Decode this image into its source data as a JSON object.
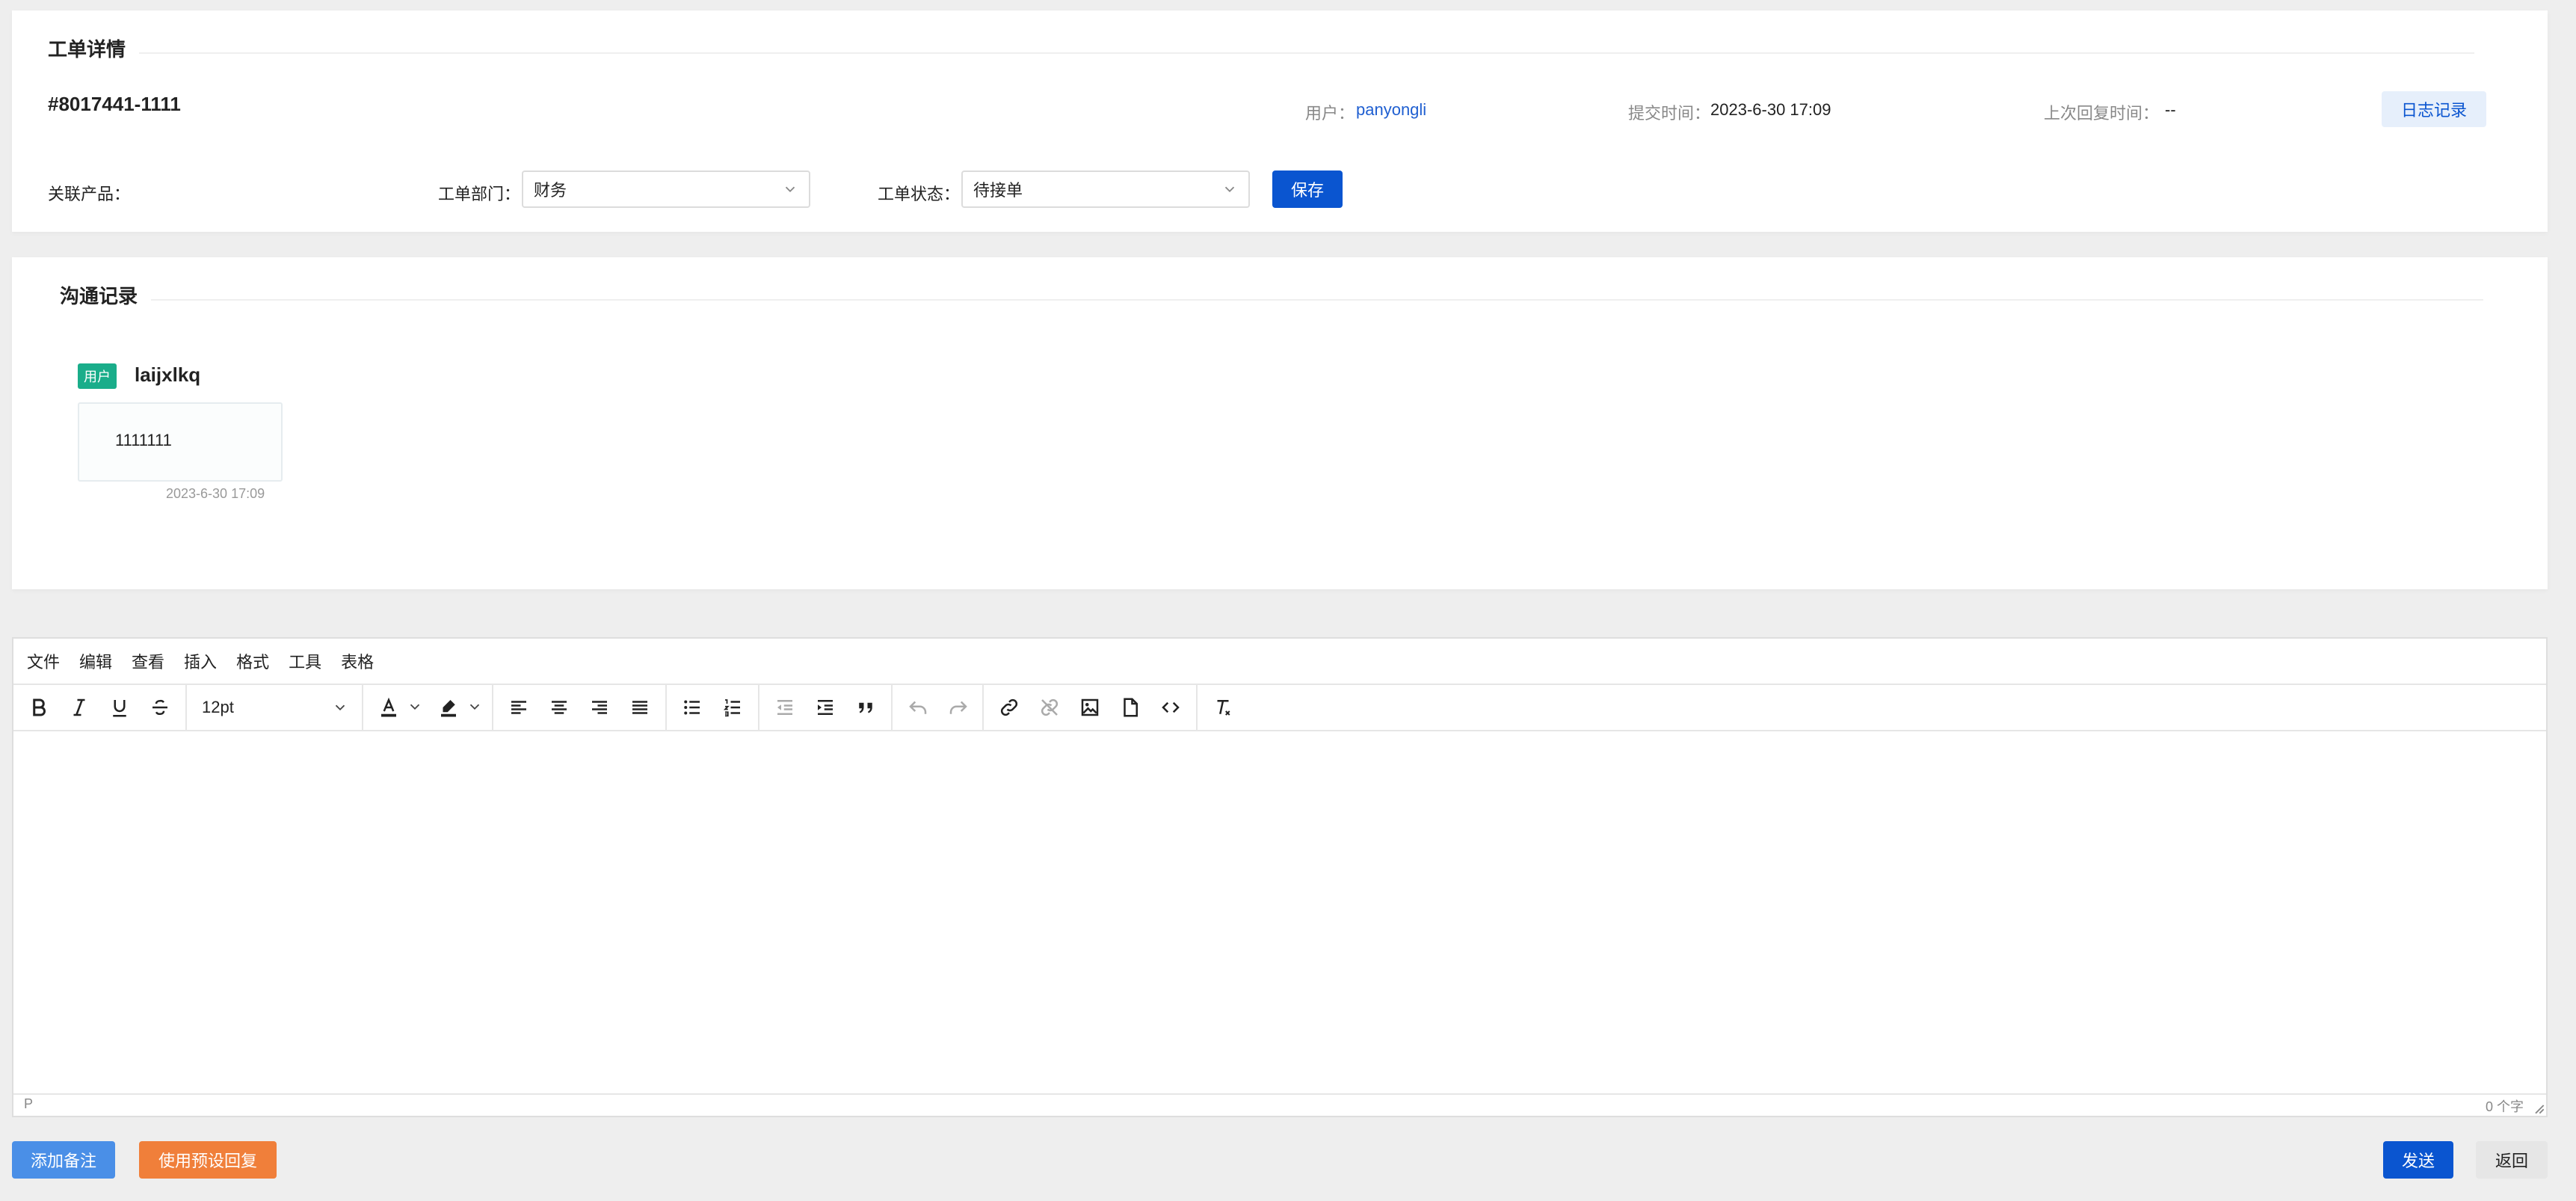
{
  "ticket": {
    "section_title": "工单详情",
    "id": "#8017441-1111",
    "user_label": "用户：",
    "user_value": "panyongli",
    "submit_label": "提交时间：",
    "submit_value": "2023-6-30 17:09",
    "last_reply_label": "上次回复时间：",
    "last_reply_value": "--",
    "log_button": "日志记录",
    "product_label": "关联产品：",
    "dept_label": "工单部门：",
    "dept_value": "财务",
    "status_label": "工单状态：",
    "status_value": "待接单",
    "save_button": "保存"
  },
  "communication": {
    "section_title": "沟通记录",
    "messages": [
      {
        "tag": "用户",
        "author": "laijxlkq",
        "content": "1111111",
        "time": "2023-6-30 17:09"
      }
    ]
  },
  "editor": {
    "menu": [
      "文件",
      "编辑",
      "查看",
      "插入",
      "格式",
      "工具",
      "表格"
    ],
    "font_size": "12pt",
    "status_path": "P",
    "word_count": "0 个字"
  },
  "footer": {
    "add_note": "添加备注",
    "preset_reply": "使用预设回复",
    "send": "发送",
    "back": "返回"
  },
  "colors": {
    "primary": "#0a55d0",
    "link": "#1f5fd1",
    "tag_green": "#1aad8a",
    "note_button": "#4a8fe7",
    "preset_button": "#f07f3a",
    "back_button": "#e6e6e6"
  }
}
